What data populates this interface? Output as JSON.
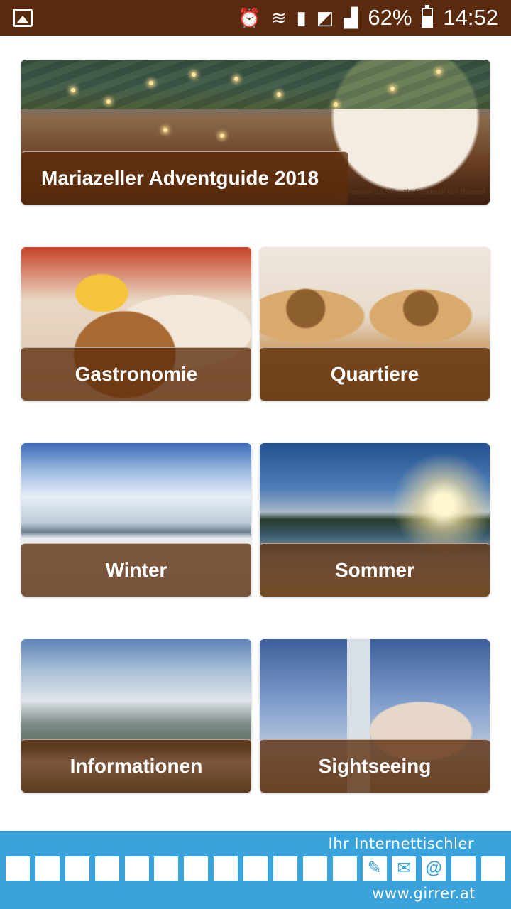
{
  "status_bar": {
    "battery": "62%",
    "time": "14:52",
    "icons": [
      "gallery-icon",
      "alarm-icon",
      "wifi-icon",
      "sim-icon",
      "no-sim-icon",
      "signal-icon",
      "battery-icon"
    ]
  },
  "tiles": {
    "advent": {
      "label": "Mariazeller Adventguide 2018",
      "brand": "mariazeller LAND   ...ein Geschenk des Himmel"
    },
    "gastronomie": {
      "label": "Gastronomie"
    },
    "quartiere": {
      "label": "Quartiere"
    },
    "winter": {
      "label": "Winter"
    },
    "sommer": {
      "label": "Sommer"
    },
    "informationen": {
      "label": "Informationen"
    },
    "sightseeing": {
      "label": "Sightseeing"
    }
  },
  "footer": {
    "title": "Ihr Internettischler",
    "url": "www.girrer.at",
    "icons": [
      "",
      "",
      "",
      "",
      "",
      "",
      "",
      "",
      "",
      "",
      "",
      "",
      "tool-icon",
      "mail-icon",
      "at-icon",
      "",
      ""
    ],
    "color": "#3aa3dc"
  },
  "colors": {
    "status_bar": "#5a2a0e",
    "label_band": "#5c2d0c"
  }
}
